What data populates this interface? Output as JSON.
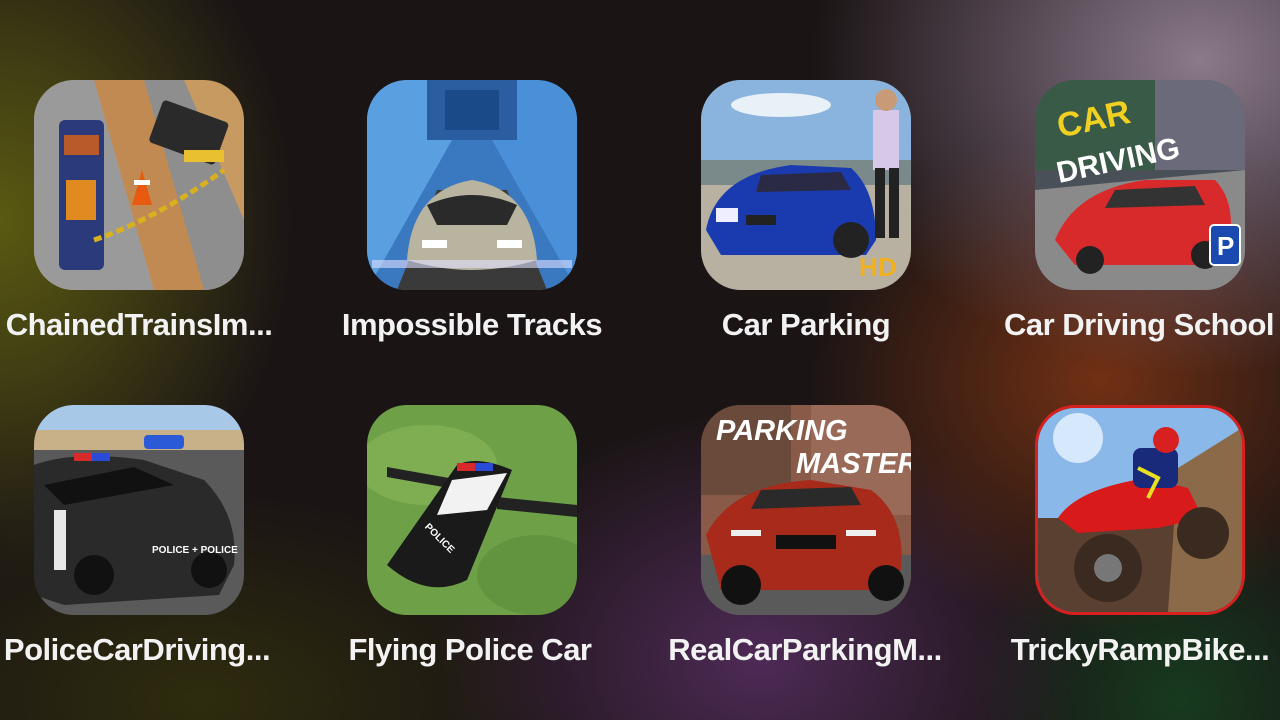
{
  "apps": [
    {
      "label": "ChainedTrainsIm...",
      "icon": "chained-trains-icon"
    },
    {
      "label": "Impossible Tracks",
      "icon": "impossible-tracks-icon"
    },
    {
      "label": "Car Parking",
      "icon": "car-parking-icon",
      "badge": "HD"
    },
    {
      "label": "Car Driving School",
      "icon": "car-driving-school-icon",
      "title_line1": "CAR",
      "title_line2": "DRIVING",
      "sign": "P"
    },
    {
      "label": "PoliceCarDriving...",
      "icon": "police-car-driving-icon",
      "car_text": "POLICE + POLICE"
    },
    {
      "label": "Flying Police Car",
      "icon": "flying-police-car-icon",
      "car_text": "POLICE"
    },
    {
      "label": "RealCarParkingM...",
      "icon": "real-car-parking-master-icon",
      "title_line1": "PARKING",
      "title_line2": "MASTER"
    },
    {
      "label": "TrickyRampBike...",
      "icon": "tricky-ramp-bike-icon"
    }
  ]
}
